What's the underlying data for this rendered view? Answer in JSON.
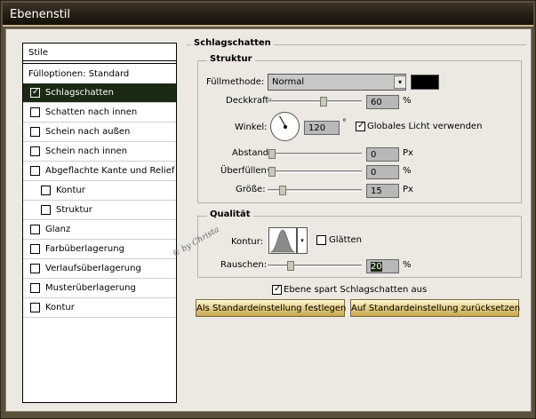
{
  "window": {
    "title": "Ebenenstil"
  },
  "left_list": {
    "header": "Stile",
    "subheader": "Fülloptionen: Standard",
    "items": [
      {
        "label": "Schlagschatten",
        "checked": true,
        "selected": true,
        "indented": false
      },
      {
        "label": "Schatten nach innen",
        "checked": false,
        "selected": false,
        "indented": false
      },
      {
        "label": "Schein nach außen",
        "checked": false,
        "selected": false,
        "indented": false
      },
      {
        "label": "Schein nach innen",
        "checked": false,
        "selected": false,
        "indented": false
      },
      {
        "label": "Abgeflachte Kante und Relief",
        "checked": false,
        "selected": false,
        "indented": false
      },
      {
        "label": "Kontur",
        "checked": false,
        "selected": false,
        "indented": true
      },
      {
        "label": "Struktur",
        "checked": false,
        "selected": false,
        "indented": true
      },
      {
        "label": "Glanz",
        "checked": false,
        "selected": false,
        "indented": false
      },
      {
        "label": "Farbüberlagerung",
        "checked": false,
        "selected": false,
        "indented": false
      },
      {
        "label": "Verlaufsüberlagerung",
        "checked": false,
        "selected": false,
        "indented": false
      },
      {
        "label": "Musterüberlagerung",
        "checked": false,
        "selected": false,
        "indented": false
      },
      {
        "label": "Kontur",
        "checked": false,
        "selected": false,
        "indented": false
      }
    ],
    "check_glyph": "✓"
  },
  "panel": {
    "section_title": "Schlagschatten",
    "structure": {
      "title": "Struktur",
      "fill_method_label": "Füllmethode:",
      "fill_method_value": "Normal",
      "dropdown_glyph": "▾",
      "shadow_color": "#000000",
      "opacity_label": "Deckkraft:",
      "opacity_value": "60",
      "opacity_unit": "%",
      "opacity_level": 0.6,
      "angle_label": "Winkel:",
      "angle_value": "120",
      "angle_unit": "°",
      "global_light_label": "Globales Licht verwenden",
      "global_light_checked": true,
      "distance_label": "Abstand:",
      "distance_value": "0",
      "distance_unit": "Px",
      "spread_label": "Überfüllen:",
      "spread_value": "0",
      "spread_unit": "%",
      "size_label": "Größe:",
      "size_value": "15",
      "size_unit": "Px"
    },
    "quality": {
      "title": "Qualität",
      "contour_label": "Kontur:",
      "antialias_label": "Glätten",
      "antialias_checked": false,
      "noise_label": "Rauschen:",
      "noise_value": "20",
      "noise_unit": "%"
    },
    "knockout_label": "Ebene spart Schlagschatten aus",
    "knockout_checked": true,
    "button_set_default": "Als Standardeinstellung festlegen",
    "button_reset_default": "Auf Standardeinstellung zurücksetzen"
  },
  "watermark": "© by Christa",
  "check_glyph": "✓"
}
